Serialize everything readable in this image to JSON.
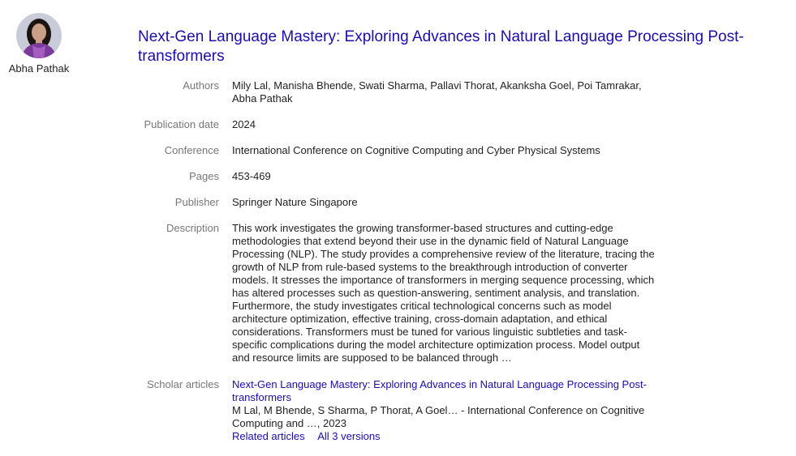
{
  "profile": {
    "name": "Abha Pathak",
    "avatar_colors": {
      "background": "#c8ccd8",
      "hair": "#1c1410",
      "skin": "#caa088",
      "saree": "#7a3a9a"
    }
  },
  "article": {
    "title": "Next-Gen Language Mastery: Exploring Advances in Natural Language Processing Post-transformers",
    "fields": {
      "authors": {
        "label": "Authors",
        "value": "Mily Lal, Manisha Bhende, Swati Sharma, Pallavi Thorat, Akanksha Goel, Poi Tamrakar, Abha Pathak"
      },
      "publication_date": {
        "label": "Publication date",
        "value": "2024"
      },
      "conference": {
        "label": "Conference",
        "value": "International Conference on Cognitive Computing and Cyber Physical Systems"
      },
      "pages": {
        "label": "Pages",
        "value": "453-469"
      },
      "publisher": {
        "label": "Publisher",
        "value": "Springer Nature Singapore"
      },
      "description": {
        "label": "Description",
        "value": "This work investigates the growing transformer-based structures and cutting-edge methodologies that extend beyond their use in the dynamic field of Natural Language Processing (NLP). The study provides a comprehensive review of the literature, tracing the growth of NLP from rule-based systems to the breakthrough introduction of converter models. It stresses the importance of transformers in merging sequence processing, which has altered processes such as question-answering, sentiment analysis, and translation. Furthermore, the study investigates critical technological concerns such as model architecture optimization, effective training, cross-domain adaptation, and ethical considerations. Transformers must be tuned for various linguistic subtleties and task-specific complications during the model architecture optimization process. Model output and resource limits are supposed to be balanced through …"
      },
      "scholar_articles": {
        "label": "Scholar articles",
        "title": "Next-Gen Language Mastery: Exploring Advances in Natural Language Processing Post-transformers",
        "citation": "M Lal, M Bhende, S Sharma, P Thorat, A Goel… - International Conference on Cognitive Computing and …, 2023",
        "related_label": "Related articles",
        "versions_label": "All 3 versions"
      }
    }
  },
  "colors": {
    "link": "#1a0dab",
    "label": "#777777",
    "text": "#222222"
  }
}
